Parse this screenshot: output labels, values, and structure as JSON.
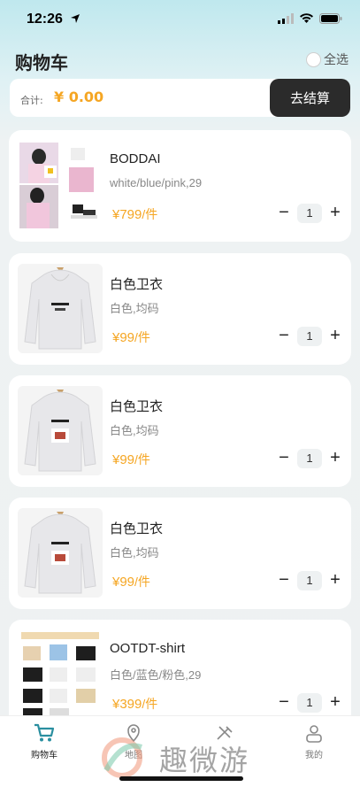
{
  "status_bar": {
    "time": "12:26"
  },
  "header": {
    "title": "购物车",
    "select_all_label": "全选"
  },
  "summary": {
    "total_label": "合计:",
    "total_value": "¥ 0.00",
    "checkout_label": "去结算"
  },
  "items": [
    {
      "name": "BODDAI",
      "spec": "white/blue/pink,29",
      "price": "¥799",
      "unit": "/件",
      "qty": "1"
    },
    {
      "name": "白色卫衣",
      "spec": "白色,均码",
      "price": "¥99",
      "unit": "/件",
      "qty": "1"
    },
    {
      "name": "白色卫衣",
      "spec": "白色,均码",
      "price": "¥99",
      "unit": "/件",
      "qty": "1"
    },
    {
      "name": "白色卫衣",
      "spec": "白色,均码",
      "price": "¥99",
      "unit": "/件",
      "qty": "1"
    },
    {
      "name": "OOTDT-shirt",
      "spec": "白色/蓝色/粉色,29",
      "price": "¥399",
      "unit": "/件",
      "qty": "1"
    }
  ],
  "tabbar": {
    "tabs": [
      {
        "label": "购物车",
        "icon": "cart-icon",
        "active": true
      },
      {
        "label": "地图",
        "icon": "map-icon"
      },
      {
        "label": "",
        "icon": "tools-icon"
      },
      {
        "label": "我的",
        "icon": "profile-icon"
      }
    ]
  },
  "watermark": "趣微游",
  "colors": {
    "accent_price": "#f5a623",
    "checkout_bg": "#2b2b2b",
    "active_tab": "#2a8fa0"
  }
}
